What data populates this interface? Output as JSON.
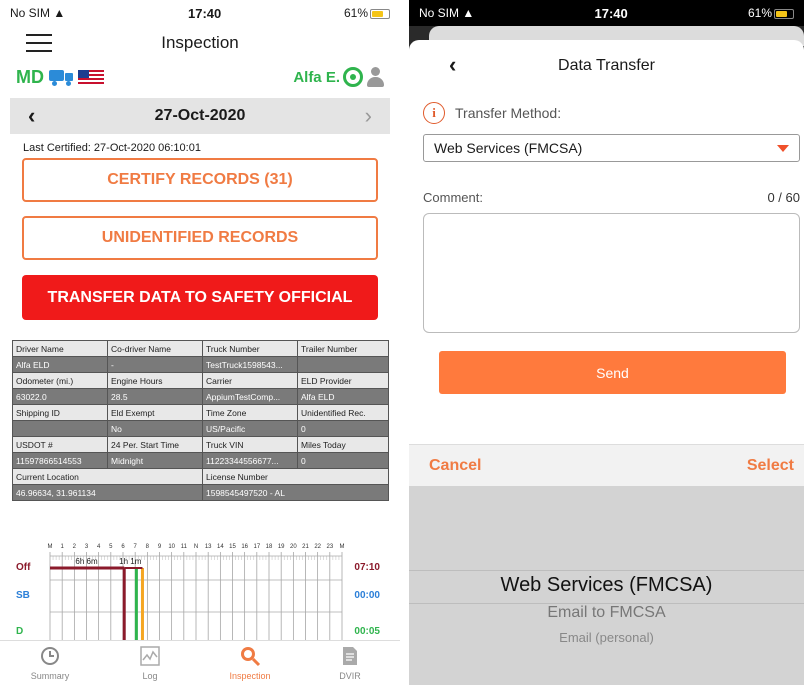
{
  "left": {
    "status": {
      "carrier": "No SIM",
      "time": "17:40",
      "battery": "61%"
    },
    "header": {
      "title": "Inspection"
    },
    "subheader": {
      "state": "MD",
      "driver": "Alfa E."
    },
    "datebar": {
      "date": "27-Oct-2020"
    },
    "last_certified": "Last Certified: 27-Oct-2020 06:10:01",
    "buttons": {
      "certify": "CERTIFY RECORDS (31)",
      "unidentified": "UNIDENTIFIED RECORDS",
      "transfer": "TRANSFER DATA TO SAFETY OFFICIAL"
    },
    "table": [
      {
        "type": "lbl",
        "cells": [
          "Driver Name",
          "Co-driver Name",
          "Truck Number",
          "Trailer Number"
        ]
      },
      {
        "type": "val",
        "cells": [
          "Alfa ELD",
          "-",
          "TestTruck1598543...",
          ""
        ]
      },
      {
        "type": "lbl",
        "cells": [
          "Odometer (mi.)",
          "Engine Hours",
          "Carrier",
          "ELD Provider"
        ]
      },
      {
        "type": "val",
        "cells": [
          "63022.0",
          "28.5",
          "AppiumTestComp...",
          "Alfa ELD"
        ]
      },
      {
        "type": "lbl",
        "cells": [
          "Shipping ID",
          "Eld Exempt",
          "Time Zone",
          "Unidentified Rec."
        ]
      },
      {
        "type": "val",
        "cells": [
          "",
          "No",
          "US/Pacific",
          "0"
        ]
      },
      {
        "type": "lbl",
        "cells": [
          "USDOT #",
          "24 Per. Start Time",
          "Truck VIN",
          "Miles Today"
        ]
      },
      {
        "type": "val",
        "cells": [
          "11597866514553",
          "Midnight",
          "11223344556677...",
          "0"
        ]
      },
      {
        "type": "lbl2",
        "cells": [
          "Current Location",
          "License Number"
        ]
      },
      {
        "type": "val2",
        "cells": [
          "46.96634, 31.961134",
          "1598545497520  -  AL"
        ]
      }
    ],
    "log_chart": {
      "hours": [
        "M",
        "1",
        "2",
        "3",
        "4",
        "5",
        "6",
        "7",
        "8",
        "9",
        "10",
        "11",
        "N",
        "13",
        "14",
        "15",
        "16",
        "17",
        "18",
        "19",
        "20",
        "21",
        "22",
        "23",
        "M"
      ],
      "rows": [
        {
          "label": "Off",
          "total": "07:10",
          "color": "#8b1a2b"
        },
        {
          "label": "SB",
          "total": "00:00",
          "color": "#2b7fd8"
        },
        {
          "label": "D",
          "total": "00:05",
          "color": "#2fb44d"
        }
      ],
      "annotations": [
        "6h 6m",
        "1h 1m"
      ]
    },
    "tabs": [
      {
        "label": "Summary",
        "icon": "clock-icon"
      },
      {
        "label": "Log",
        "icon": "log-chart-icon"
      },
      {
        "label": "Inspection",
        "icon": "inspection-icon"
      },
      {
        "label": "DVIR",
        "icon": "dvir-document-icon"
      }
    ]
  },
  "right": {
    "status": {
      "carrier": "No SIM",
      "time": "17:40",
      "battery": "61%"
    },
    "title": "Data Transfer",
    "transfer_method_label": "Transfer Method:",
    "selected_method": "Web Services (FMCSA)",
    "comment_label": "Comment:",
    "comment_count": "0 / 60",
    "send_label": "Send",
    "picker": {
      "cancel": "Cancel",
      "select": "Select",
      "options": [
        "Web Services (FMCSA)",
        "Email to FMCSA",
        "Email (personal)"
      ]
    }
  },
  "colors": {
    "accent": "#f07b43",
    "danger": "#f01a1a",
    "brand_green": "#2fb44d"
  }
}
